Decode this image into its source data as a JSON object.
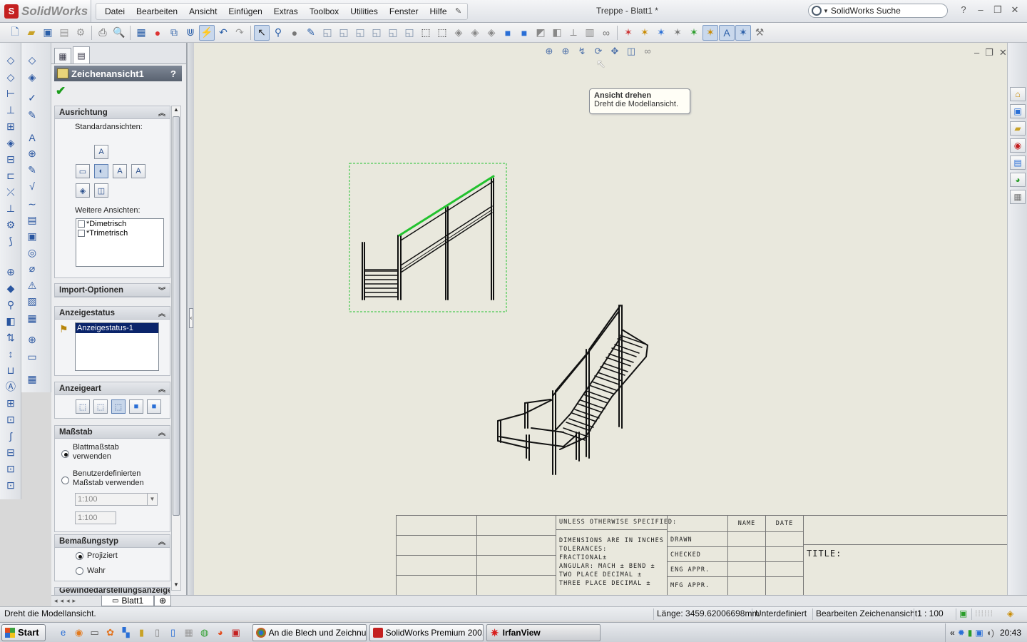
{
  "app": {
    "logo_text": "SolidWorks",
    "document_title": "Treppe - Blatt1 *"
  },
  "menu": {
    "items": [
      "Datei",
      "Bearbeiten",
      "Ansicht",
      "Einfügen",
      "Extras",
      "Toolbox",
      "Utilities",
      "Fenster",
      "Hilfe"
    ]
  },
  "search": {
    "placeholder": "SolidWorks Suche"
  },
  "window_controls": {
    "help": "?",
    "minimize": "–",
    "restore": "❐",
    "close": "✕"
  },
  "property_manager": {
    "title": "Zeichenansicht1",
    "help": "?",
    "ausrichtung": {
      "title": "Ausrichtung",
      "standard_label": "Standardansichten:",
      "weitere_label": "Weitere Ansichten:",
      "list": [
        "*Dimetrisch",
        "*Trimetrisch"
      ]
    },
    "import": {
      "title": "Import-Optionen"
    },
    "anzeigestatus": {
      "title": "Anzeigestatus",
      "item": "Anzeigestatus-1"
    },
    "anzeigeart": {
      "title": "Anzeigeart"
    },
    "massstab": {
      "title": "Maßstab",
      "opt1": "Blattmaßstab verwenden",
      "opt2": "Benutzerdefinierten Maßstab verwenden",
      "select_value": "1:100",
      "text_value": "1:100"
    },
    "bemassung": {
      "title": "Bemaßungstyp",
      "opt1": "Projiziert",
      "opt2": "Wahr"
    },
    "gewinde": {
      "title": "Gewindedarstellungsanzeige"
    }
  },
  "tooltip": {
    "title": "Ansicht drehen",
    "text": "Dreht die Modellansicht."
  },
  "title_block": {
    "unless": "UNLESS OTHERWISE SPECIFIED:",
    "name": "NAME",
    "date": "DATE",
    "dims": "DIMENSIONS ARE IN INCHES",
    "tol": "TOLERANCES:",
    "frac": "FRACTIONAL±",
    "ang": "ANGULAR: MACH ±    BEND ±",
    "two": "TWO PLACE DECIMAL    ±",
    "three": "THREE PLACE DECIMAL  ±",
    "drawn": "DRAWN",
    "checked": "CHECKED",
    "eng": "ENG APPR.",
    "mfg": "MFG APPR.",
    "title": "TITLE:"
  },
  "sheet_tab": {
    "name": "Blatt1"
  },
  "status": {
    "message": "Dreht die Modellansicht.",
    "length": "Länge: 3459.62006698mm",
    "defined": "Unterdefiniert",
    "editing": "Bearbeiten Zeichenansicht1",
    "scale": "1 : 100"
  },
  "taskbar": {
    "start": "Start",
    "tasks": [
      "An die Blech und Zeichnu...",
      "SolidWorks Premium 200...",
      "IrfanView"
    ],
    "clock": "20:43"
  },
  "colors": {
    "canvas": "#e9e8dd",
    "selection": "#22c22e",
    "header": "#596270",
    "accent": "#c42020"
  }
}
